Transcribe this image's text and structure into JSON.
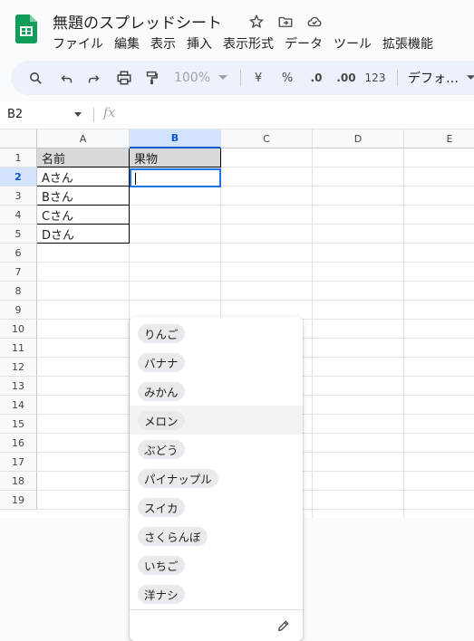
{
  "app": {
    "doc_title": "無題のスプレッドシート",
    "menu": [
      "ファイル",
      "編集",
      "表示",
      "挿入",
      "表示形式",
      "データ",
      "ツール",
      "拡張機能"
    ]
  },
  "toolbar": {
    "zoom": "100%",
    "currency": "¥",
    "percent": "%",
    "dec_decrease": ".0",
    "dec_increase": ".00",
    "number_format": "123",
    "font": "デフォ…"
  },
  "formula_bar": {
    "cell_ref": "B2",
    "fx": "fx"
  },
  "grid": {
    "columns": [
      "A",
      "B",
      "C",
      "D",
      "E"
    ],
    "rows": [
      "1",
      "2",
      "3",
      "4",
      "5",
      "6",
      "7",
      "8",
      "9",
      "10",
      "11",
      "12",
      "13",
      "14",
      "15",
      "16",
      "17",
      "18",
      "19"
    ],
    "header_row": [
      "名前",
      "果物"
    ],
    "names": [
      "Aさん",
      "Bさん",
      "Cさん",
      "Dさん"
    ]
  },
  "dropdown": {
    "options": [
      "りんご",
      "バナナ",
      "みかん",
      "メロン",
      "ぶどう",
      "パイナップル",
      "スイカ",
      "さくらんぼ",
      "いちご",
      "洋ナシ"
    ],
    "highlighted": "メロン"
  },
  "colors": {
    "selection": "#1a73e8",
    "header_fill": "#d9d9d9",
    "sheets_green": "#0f9d58"
  }
}
